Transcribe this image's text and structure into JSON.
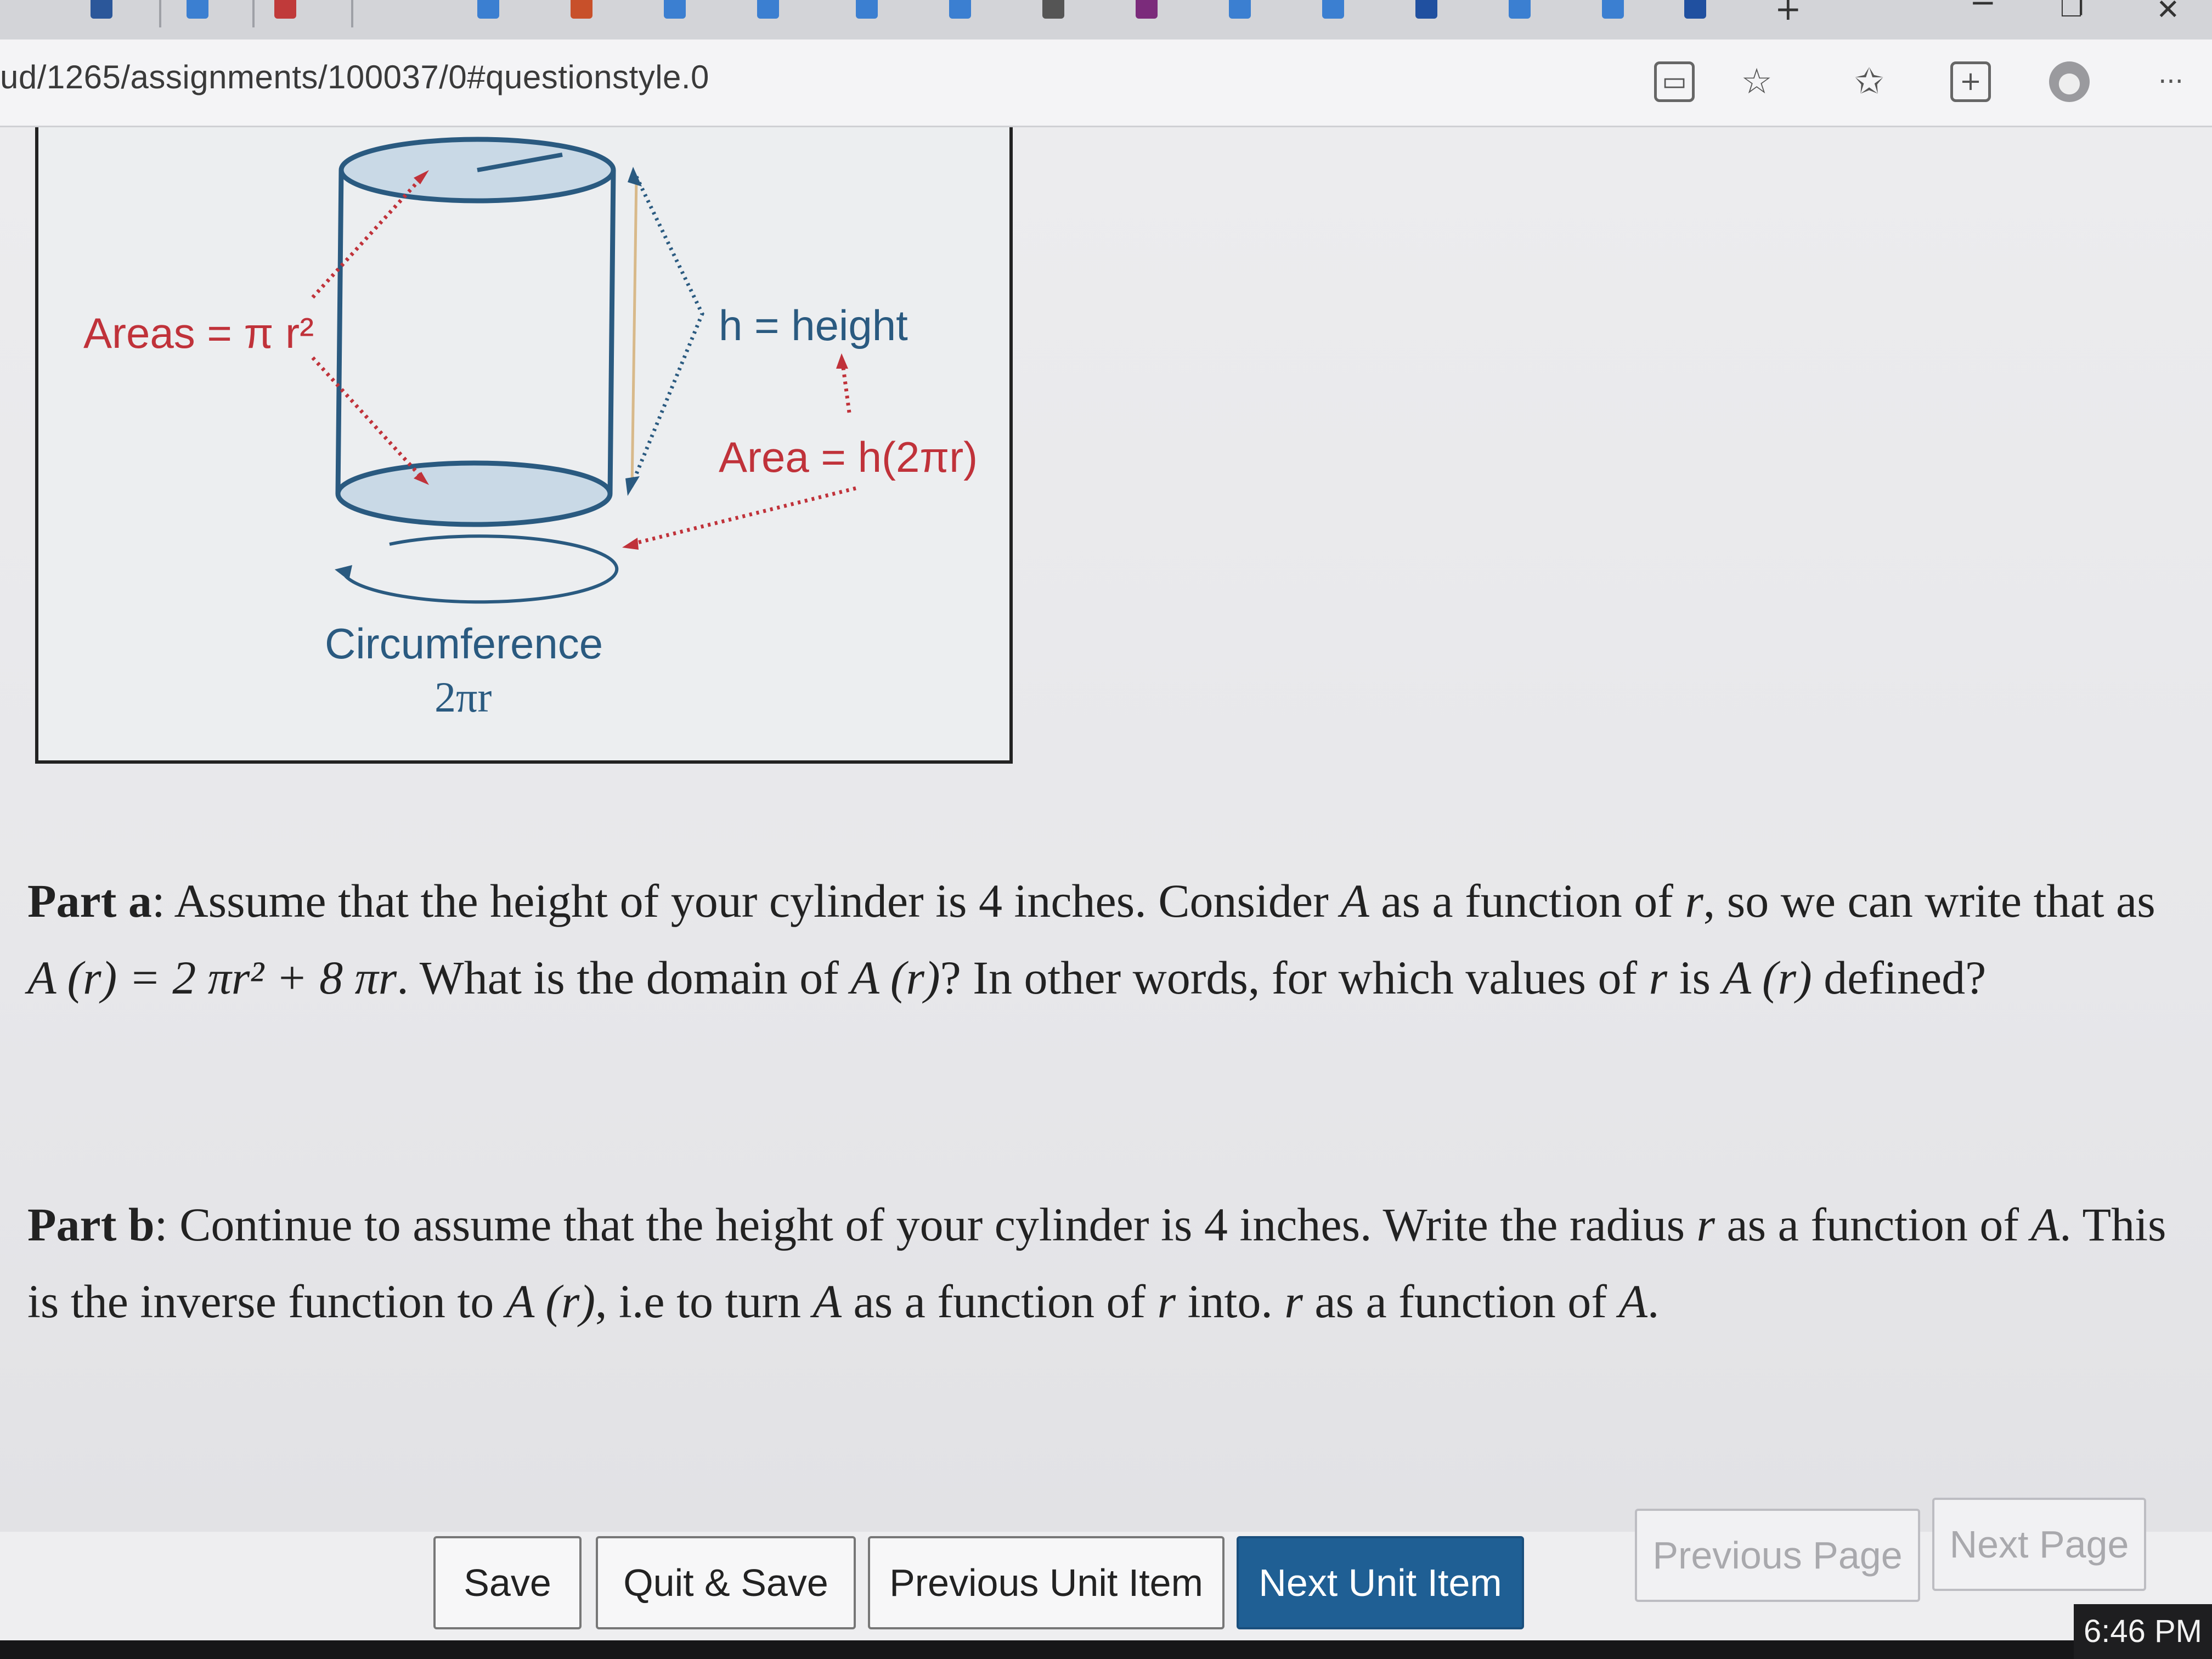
{
  "browser": {
    "url": "ud/1265/assignments/100037/0#questionstyle.0",
    "more_label": "···",
    "window_close": "✕",
    "window_restore": "❐"
  },
  "figure": {
    "label_areas": "Areas = π r²",
    "label_height": "h = height",
    "label_area_side": "Area = h(2πr)",
    "label_circumference": "Circumference",
    "label_circumference_formula": "2πr"
  },
  "question": {
    "part_a_title": "Part a",
    "part_a_text_1": ": Assume that the height of your cylinder is 4 inches. Consider ",
    "part_a_var_A": "A",
    "part_a_text_2": " as a function of ",
    "part_a_var_r": "r",
    "part_a_text_3": ", so we can write that as ",
    "part_a_formula": "A (r) = 2 πr² + 8 πr",
    "part_a_text_4": ". What is the domain of ",
    "part_a_func": "A (r)",
    "part_a_text_5": "? In other words, for which values of ",
    "part_a_var_r2": "r",
    "part_a_text_6": " is ",
    "part_a_func2": "A (r)",
    "part_a_text_7": " defined?",
    "part_b_title": "Part b",
    "part_b_text_1": ": Continue to assume that the height of your cylinder is 4 inches. Write the radius ",
    "part_b_var_r": "r",
    "part_b_text_2": " as a function of ",
    "part_b_var_A": "A",
    "part_b_text_3": ". This is the inverse function to ",
    "part_b_func": "A (r)",
    "part_b_text_4": ", i.e to turn ",
    "part_b_var_A2": "A",
    "part_b_text_5": " as a function of ",
    "part_b_var_r2": "r",
    "part_b_text_6": " into. ",
    "part_b_var_r3": "r",
    "part_b_text_7": " as a function of ",
    "part_b_var_A3": "A",
    "part_b_text_8": "."
  },
  "buttons": {
    "save": "Save",
    "quit_save": "Quit & Save",
    "previous_unit_item": "Previous Unit Item",
    "next_unit_item": "Next Unit Item",
    "previous_page": "Previous Page",
    "next_page": "Next Page"
  },
  "taskbar": {
    "time": "6:46 PM"
  },
  "colors": {
    "primary_button": "#1f5f94",
    "figure_red": "#c0323a",
    "figure_blue": "#2a5a80"
  }
}
